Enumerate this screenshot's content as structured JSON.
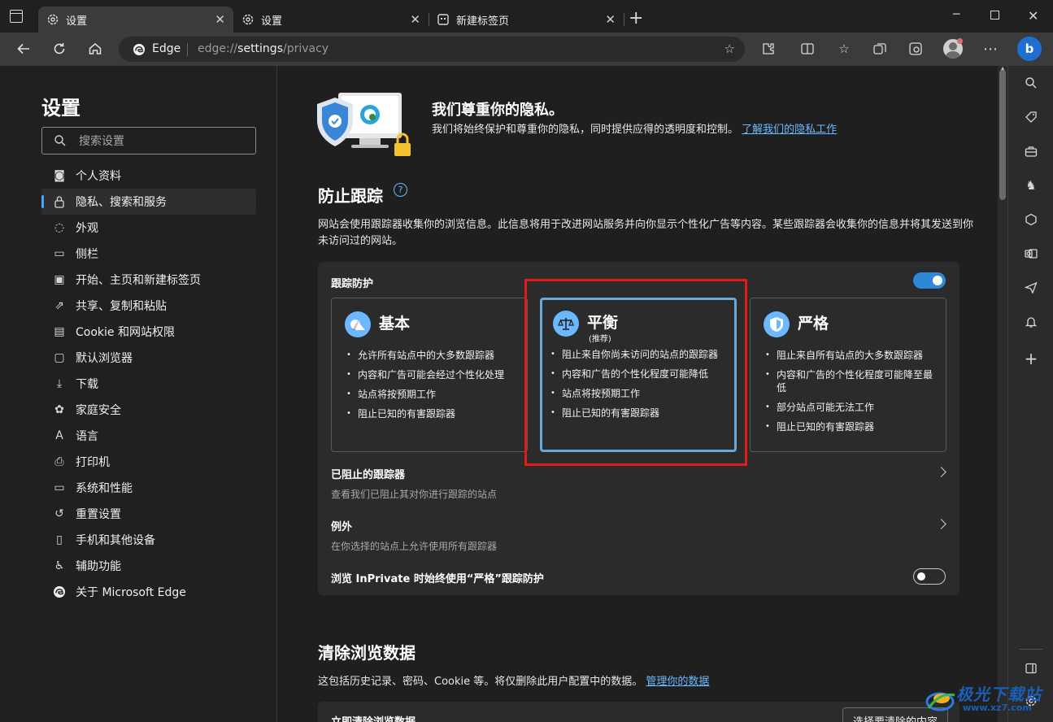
{
  "tabs": [
    {
      "label": "设置",
      "icon": "gear-icon",
      "active": true
    },
    {
      "label": "设置",
      "icon": "gear-icon",
      "active": false
    },
    {
      "label": "新建标签页",
      "icon": "new-tab-icon",
      "active": false
    }
  ],
  "address_bar": {
    "brand": "Edge",
    "url_prefix": "edge://",
    "url_path": "settings",
    "url_suffix": "/privacy"
  },
  "left_nav": {
    "title": "设置",
    "search_placeholder": "搜索设置",
    "items": [
      {
        "label": "个人资料",
        "icon": "profile-icon"
      },
      {
        "label": "隐私、搜索和服务",
        "icon": "lock-icon",
        "active": true
      },
      {
        "label": "外观",
        "icon": "palette-icon"
      },
      {
        "label": "侧栏",
        "icon": "sidebar-icon"
      },
      {
        "label": "开始、主页和新建标签页",
        "icon": "home-tab-icon"
      },
      {
        "label": "共享、复制和粘贴",
        "icon": "share-icon"
      },
      {
        "label": "Cookie 和网站权限",
        "icon": "site-permissions-icon"
      },
      {
        "label": "默认浏览器",
        "icon": "default-browser-icon"
      },
      {
        "label": "下载",
        "icon": "download-icon"
      },
      {
        "label": "家庭安全",
        "icon": "family-icon"
      },
      {
        "label": "语言",
        "icon": "language-icon"
      },
      {
        "label": "打印机",
        "icon": "printer-icon"
      },
      {
        "label": "系统和性能",
        "icon": "laptop-icon"
      },
      {
        "label": "重置设置",
        "icon": "reset-icon"
      },
      {
        "label": "手机和其他设备",
        "icon": "phone-icon"
      },
      {
        "label": "辅助功能",
        "icon": "accessibility-icon"
      },
      {
        "label": "关于 Microsoft Edge",
        "icon": "edge-logo-icon"
      }
    ]
  },
  "hero": {
    "title": "我们尊重你的隐私。",
    "desc": "我们将始终保护和尊重你的隐私，同时提供应得的透明度和控制。",
    "link": "了解我们的隐私工作"
  },
  "tracking": {
    "section_title": "防止跟踪",
    "desc": "网站会使用跟踪器收集你的浏览信息。此信息将用于改进网站服务并向你显示个性化广告等内容。某些跟踪器会收集你的信息并将其发送到你未访问过的网站。",
    "toggle_label": "跟踪防护",
    "toggle_on": true,
    "options": [
      {
        "name": "基本",
        "subtitle": "",
        "bullets": [
          "允许所有站点中的大多数跟踪器",
          "内容和广告可能会经过个性化处理",
          "站点将按预期工作",
          "阻止已知的有害跟踪器"
        ]
      },
      {
        "name": "平衡",
        "subtitle": "(推荐)",
        "selected": true,
        "bullets": [
          "阻止来自你尚未访问的站点的跟踪器",
          "内容和广告的个性化程度可能降低",
          "站点将按预期工作",
          "阻止已知的有害跟踪器"
        ]
      },
      {
        "name": "严格",
        "subtitle": "",
        "bullets": [
          "阻止来自所有站点的大多数跟踪器",
          "内容和广告的个性化程度可能降至最低",
          "部分站点可能无法工作",
          "阻止已知的有害跟踪器"
        ]
      }
    ],
    "blocked_title": "已阻止的跟踪器",
    "blocked_sub": "查看我们已阻止其对你进行跟踪的站点",
    "exceptions_title": "例外",
    "exceptions_sub": "在你选择的站点上允许使用所有跟踪器",
    "inprivate_label": "浏览 InPrivate 时始终使用“严格”跟踪防护",
    "inprivate_on": false
  },
  "clear_data": {
    "section_title": "清除浏览数据",
    "desc": "这包括历史记录、密码、Cookie 等。将仅删除此用户配置中的数据。",
    "link": "管理你的数据",
    "row_title": "立即清除浏览数据",
    "button": "选择要清除的内容"
  },
  "watermark": {
    "text": "极光下载站",
    "url": "www.xz7.com"
  },
  "colors": {
    "accent": "#6cb8ff",
    "highlight_border": "#e01b1b",
    "selected_option_border": "#68a9d9",
    "toggle_on": "#2f87d8"
  }
}
